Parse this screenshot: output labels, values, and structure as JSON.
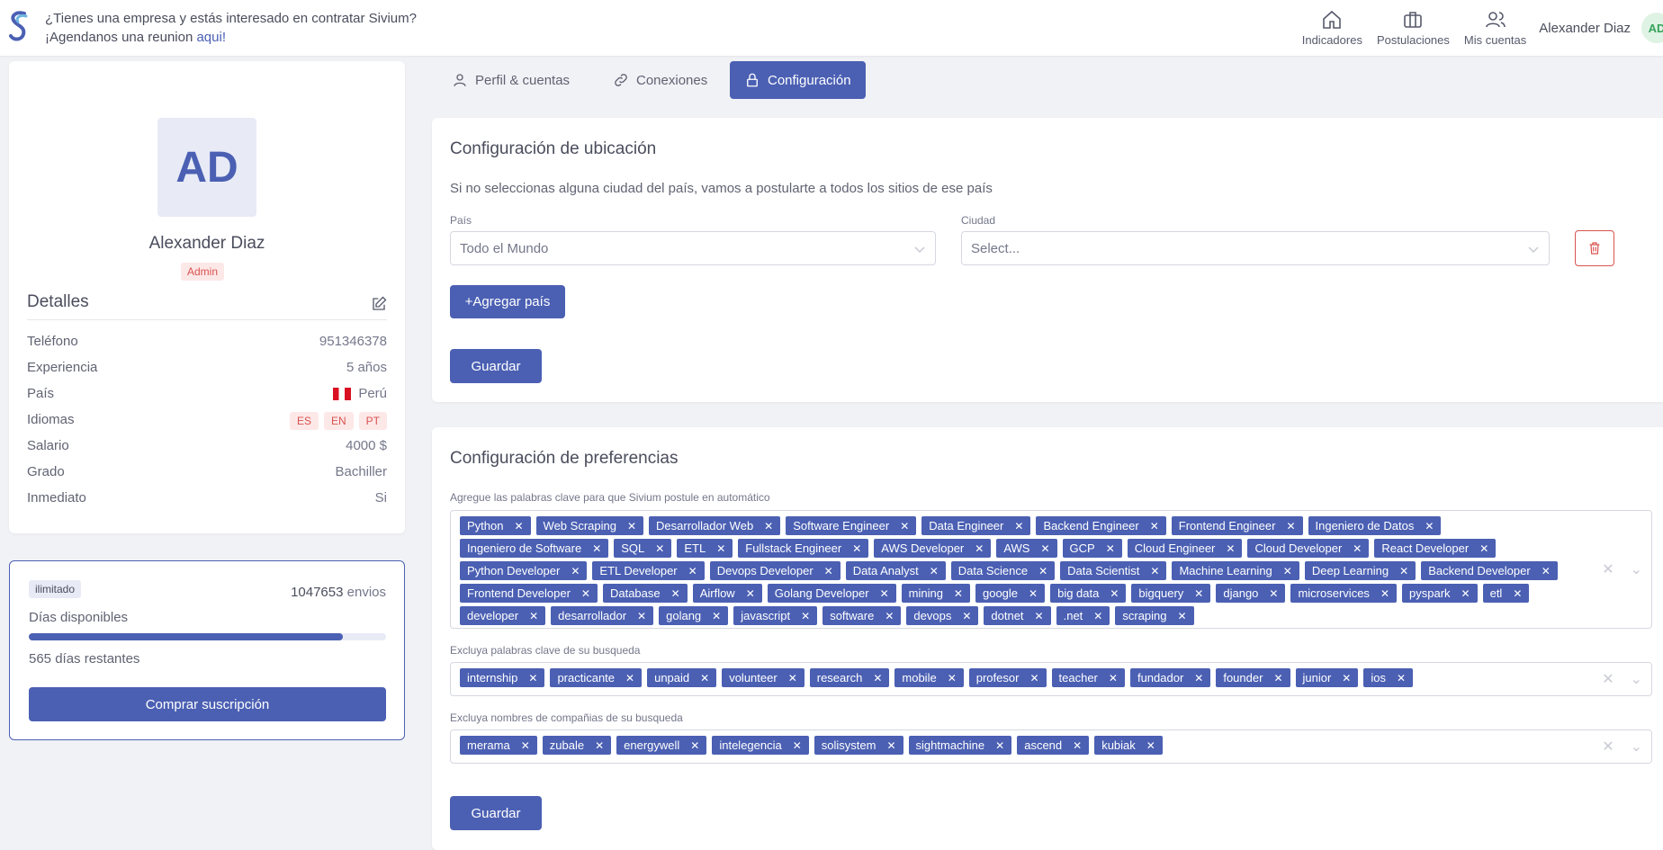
{
  "header": {
    "promo_line1": "¿Tienes una empresa y estás interesado en contratar Sivium?",
    "promo_line2_prefix": "¡Agendanos una reunion ",
    "promo_line2_link": "aqui!",
    "nav": [
      {
        "label": "Indicadores",
        "icon": "home-icon"
      },
      {
        "label": "Postulaciones",
        "icon": "briefcase-icon"
      },
      {
        "label": "Mis cuentas",
        "icon": "users-icon"
      }
    ],
    "user_name": "Alexander Diaz",
    "user_initials": "AD"
  },
  "profile": {
    "initials": "AD",
    "name": "Alexander Diaz",
    "role_badge": "Admin",
    "details_title": "Detalles",
    "rows": [
      {
        "label": "Teléfono",
        "value": "951346378"
      },
      {
        "label": "Experiencia",
        "value": "5 años"
      },
      {
        "label": "País",
        "value": "Perú"
      },
      {
        "label": "Idiomas",
        "value": ""
      },
      {
        "label": "Salario",
        "value": "4000 $"
      },
      {
        "label": "Grado",
        "value": "Bachiller"
      },
      {
        "label": "Inmediato",
        "value": "Si"
      }
    ],
    "languages": [
      "ES",
      "EN",
      "PT"
    ]
  },
  "subscription": {
    "plan_badge": "ilimitado",
    "envios_count": "1047653",
    "envios_label": "envios",
    "dias_label": "Días disponibles",
    "progress_fraction": 0.88,
    "remaining": "565 días restantes",
    "buy_label": "Comprar suscripción"
  },
  "tabs": [
    {
      "label": "Perfil & cuentas",
      "icon": "user-icon"
    },
    {
      "label": "Conexiones",
      "icon": "link-icon"
    },
    {
      "label": "Configuración",
      "icon": "lock-icon",
      "active": true
    }
  ],
  "ubicacion": {
    "title": "Configuración de ubicación",
    "hint": "Si no seleccionas alguna ciudad del país, vamos a postularte a todos los sitios de ese país",
    "pais_label": "País",
    "pais_value": "Todo el Mundo",
    "ciudad_label": "Ciudad",
    "ciudad_placeholder": "Select...",
    "add_country": "+Agregar país",
    "save": "Guardar"
  },
  "preferencias": {
    "title": "Configuración de preferencias",
    "keywords_label": "Agregue las palabras clave para que Sivium postule en automático",
    "keywords": [
      "Python",
      "Web Scraping",
      "Desarrollador Web",
      "Software Engineer",
      "Data Engineer",
      "Backend Engineer",
      "Frontend Engineer",
      "Ingeniero de Datos",
      "Ingeniero de Software",
      "SQL",
      "ETL",
      "Fullstack Engineer",
      "AWS Developer",
      "AWS",
      "GCP",
      "Cloud Engineer",
      "Cloud Developer",
      "React Developer",
      "Python Developer",
      "ETL Developer",
      "Devops Developer",
      "Data Analyst",
      "Data Science",
      "Data Scientist",
      "Machine Learning",
      "Deep Learning",
      "Backend Developer",
      "Frontend Developer",
      "Database",
      "Airflow",
      "Golang Developer",
      "mining",
      "google",
      "big data",
      "bigquery",
      "django",
      "microservices",
      "pyspark",
      "etl",
      "developer",
      "desarrollador",
      "golang",
      "javascript",
      "software",
      "devops",
      "dotnet",
      ".net",
      "scraping"
    ],
    "exclude_keywords_label": "Excluya palabras clave de su busqueda",
    "exclude_keywords": [
      "internship",
      "practicante",
      "unpaid",
      "volunteer",
      "research",
      "mobile",
      "profesor",
      "teacher",
      "fundador",
      "founder",
      "junior",
      "ios"
    ],
    "exclude_companies_label": "Excluya nombres de compañias de su busqueda",
    "exclude_companies": [
      "merama",
      "zubale",
      "energywell",
      "intelegencia",
      "solisystem",
      "sightmachine",
      "ascend",
      "kubiak"
    ],
    "save": "Guardar"
  }
}
